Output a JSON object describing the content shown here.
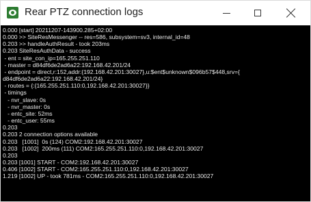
{
  "window": {
    "title": "Rear PTZ connection logs",
    "icon": "camera-app-icon",
    "controls": [
      "minimize-icon",
      "maximize-icon",
      "close-icon"
    ]
  },
  "colors": {
    "titlebar_bg": "#ffffff",
    "console_bg": "#000000",
    "console_text": "#ececec",
    "app_icon": "#2e7d32"
  },
  "log_lines": [
    "0.000 [start] 20211207-143900.285+02:00",
    "0.000 >> SiteResMessenger -- res=586, subsystem=sv3, internal_id=48",
    "0.203 >> handleAuthResult - took 203ms",
    "0.203 SiteResAuthData - success",
    " - ent = site_con_ip=165.255.251.110",
    " - master = d84df6de2ad6a22:192.168.42.201/24",
    " - endpoint = direct,r:152,addr:{192.168.42.201:30027},u:$ent$unknown$096b57$448,srv={",
    "d84df6de2ad6a22:192.168.42.201/24}",
    " - routes = {:{165.255.251.110:0,192.168.42.201:30027}}",
    " - timings",
    "   - nvr_slave: 0s",
    "   - nvr_master: 0s",
    "   - entc_site: 52ms",
    "   - entc_user: 55ms",
    "0.203",
    "0.203 2 connection options available",
    "0.203   [1001]  0s (124) COM2:192.168.42.201:30027",
    "0.203   [1002]  200ms (111) COM2:165.255.251.110:0,192.168.42.201:30027",
    "0.203",
    "0.203 [1001] START - COM2:192.168.42.201:30027",
    "0.406 [1002] START - COM2:165.255.251.110:0,192.168.42.201:30027",
    "1.219 [1002] UP - took 781ms - COM2:165.255.251.110:0,192.168.42.201:30027"
  ]
}
